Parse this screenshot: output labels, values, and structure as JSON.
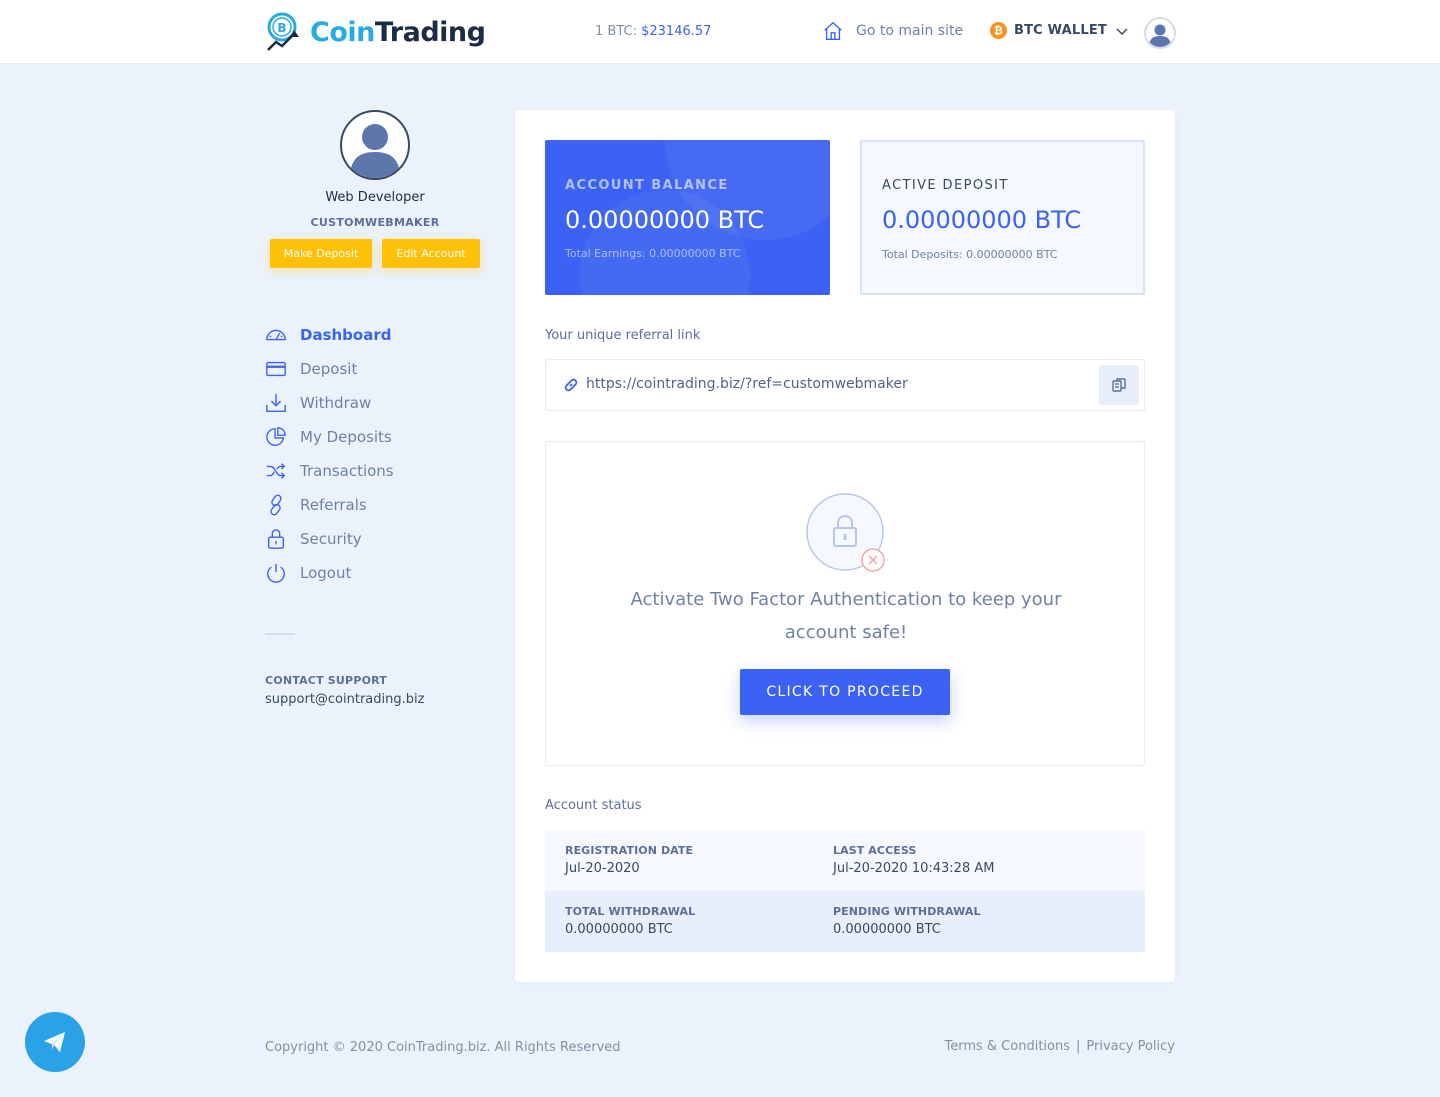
{
  "header": {
    "logo_coin": "Coin",
    "logo_trading": "Trading",
    "btc_price_label": "1 BTC:",
    "btc_price_value": "$23146.57",
    "main_site_label": "Go to main site",
    "wallet_label": "BTC WALLET",
    "wallet_symbol": "₿"
  },
  "profile": {
    "name": "Web Developer",
    "username": "CUSTOMWEBMAKER",
    "make_deposit_label": "Make Deposit",
    "edit_account_label": "Edit Account"
  },
  "nav": {
    "items": [
      {
        "label": "Dashboard",
        "icon": "dashboard-icon",
        "active": true
      },
      {
        "label": "Deposit",
        "icon": "card-icon"
      },
      {
        "label": "Withdraw",
        "icon": "download-icon"
      },
      {
        "label": "My Deposits",
        "icon": "pie-chart-icon"
      },
      {
        "label": "Transactions",
        "icon": "shuffle-icon"
      },
      {
        "label": "Referrals",
        "icon": "link-icon"
      },
      {
        "label": "Security",
        "icon": "lock-icon"
      },
      {
        "label": "Logout",
        "icon": "power-icon"
      }
    ]
  },
  "support": {
    "title": "CONTACT SUPPORT",
    "email": "support@cointrading.biz"
  },
  "balance": {
    "label": "ACCOUNT BALANCE",
    "value": "0.00000000 BTC",
    "sub": "Total Earnings: 0.00000000 BTC"
  },
  "active_deposit": {
    "label": "ACTIVE DEPOSIT",
    "value": "0.00000000 BTC",
    "sub": "Total Deposits: 0.00000000 BTC"
  },
  "referral": {
    "title": "Your unique referral link",
    "link": "https://cointrading.biz/?ref=customwebmaker"
  },
  "tfa": {
    "line1": "Activate Two Factor Authentication to keep your",
    "line2": "account safe!",
    "button_label": "CLICK TO PROCEED"
  },
  "account_status": {
    "title": "Account status",
    "registration_label": "REGISTRATION DATE",
    "registration_value": "Jul-20-2020",
    "last_access_label": "LAST ACCESS",
    "last_access_value": "Jul-20-2020 10:43:28 AM",
    "total_withdrawal_label": "TOTAL WITHDRAWAL",
    "total_withdrawal_value": "0.00000000 BTC",
    "pending_withdrawal_label": "PENDING WITHDRAWAL",
    "pending_withdrawal_value": "0.00000000 BTC"
  },
  "footer": {
    "copyright": "Copyright © 2020 CoinTrading.biz. All Rights Reserved",
    "terms": "Terms & Conditions",
    "separator": "|",
    "privacy": "Privacy Policy"
  },
  "colors": {
    "primary": "#3b62f2",
    "accent_yellow": "#ffc107",
    "background": "#ebf2fc",
    "telegram": "#2aa3e6",
    "bitcoin": "#f7931a"
  }
}
